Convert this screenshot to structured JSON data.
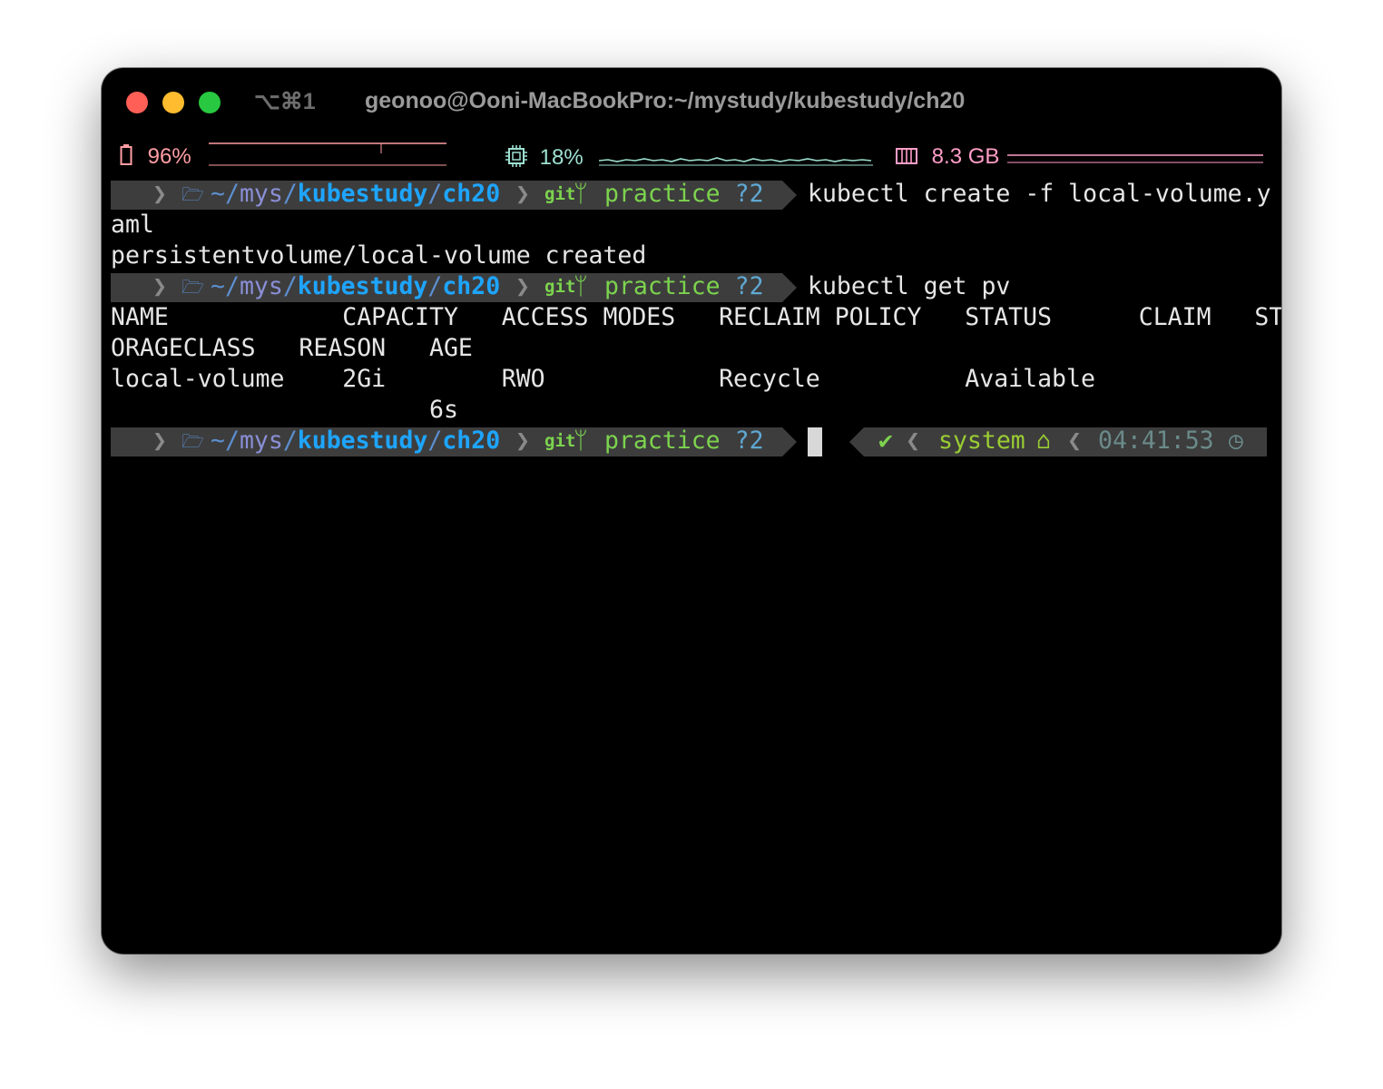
{
  "window": {
    "shortcut": "⌥⌘1",
    "title": "geonoo@Ooni-MacBookPro:~/mystudy/kubestudy/ch20"
  },
  "status_bar": {
    "battery": {
      "icon": "battery-icon",
      "value": "96%",
      "level": 0.96,
      "color": "#ff9ea4"
    },
    "cpu": {
      "icon": "cpu-icon",
      "value": "18%",
      "level": 0.18,
      "color": "#9de0d0"
    },
    "memory": {
      "icon": "memory-icon",
      "value": "8.3 GB",
      "color": "#ff9ec8"
    }
  },
  "prompt": {
    "apple_icon": "",
    "folder_icon": "🗁",
    "dir_home": "~",
    "dir_slash1": "/",
    "dir_mys": "mys",
    "dir_slash2": "/",
    "dir_kubestudy": "kubestudy",
    "dir_slash3": "/",
    "dir_ch20": "ch20",
    "git_label": "git",
    "branch_icon": "ᛘ",
    "branch": "practice",
    "untracked": "?2"
  },
  "lines": {
    "cmd1": "kubectl create -f local-volume.y",
    "cmd1_wrap": "aml",
    "out1": "persistentvolume/local-volume created",
    "cmd2": "kubectl get pv",
    "header1": "NAME            CAPACITY   ACCESS MODES   RECLAIM POLICY   STATUS      CLAIM   ST",
    "header2": "ORAGECLASS   REASON   AGE",
    "row1": "local-volume    2Gi        RWO            Recycle          Available",
    "row2": "                      6s"
  },
  "right_prompt": {
    "check": "✔",
    "user": "system",
    "home_icon": "⌂",
    "time": "04:41:53",
    "clock_icon": "◷"
  }
}
